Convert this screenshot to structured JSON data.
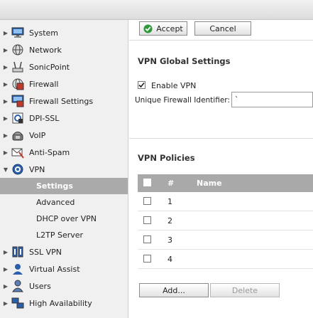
{
  "sidebar": {
    "items": [
      {
        "label": "System",
        "icon": "monitor-icon",
        "expanded": false
      },
      {
        "label": "Network",
        "icon": "globe-icon",
        "expanded": false
      },
      {
        "label": "SonicPoint",
        "icon": "access-point-icon",
        "expanded": false
      },
      {
        "label": "Firewall",
        "icon": "firewall-icon",
        "expanded": false
      },
      {
        "label": "Firewall Settings",
        "icon": "firewall-settings-icon",
        "expanded": false
      },
      {
        "label": "DPI-SSL",
        "icon": "dpi-ssl-icon",
        "expanded": false
      },
      {
        "label": "VoIP",
        "icon": "phone-icon",
        "expanded": false
      },
      {
        "label": "Anti-Spam",
        "icon": "mail-icon",
        "expanded": false
      },
      {
        "label": "VPN",
        "icon": "vpn-icon",
        "expanded": true
      },
      {
        "label": "SSL VPN",
        "icon": "ssl-vpn-icon",
        "expanded": false
      },
      {
        "label": "Virtual Assist",
        "icon": "assist-icon",
        "expanded": false
      },
      {
        "label": "Users",
        "icon": "users-icon",
        "expanded": false
      },
      {
        "label": "High Availability",
        "icon": "ha-icon",
        "expanded": false
      }
    ],
    "vpn_sub": [
      "Settings",
      "Advanced",
      "DHCP over VPN",
      "L2TP Server"
    ],
    "active_sub": "Settings"
  },
  "toolbar": {
    "accept_label": "Accept",
    "cancel_label": "Cancel"
  },
  "global": {
    "title": "VPN Global Settings",
    "enable_label": "Enable VPN",
    "enable_checked": true,
    "identifier_label": "Unique Firewall Identifier:",
    "identifier_value": "`"
  },
  "policies": {
    "title": "VPN Policies",
    "col_num": "#",
    "col_name": "Name",
    "rows": [
      {
        "num": "1",
        "name": ""
      },
      {
        "num": "2",
        "name": ""
      },
      {
        "num": "3",
        "name": ""
      },
      {
        "num": "4",
        "name": ""
      }
    ],
    "add_label": "Add...",
    "delete_label": "Delete"
  },
  "colors": {
    "active_sub_bg": "#aaaaaa",
    "table_head_bg": "#a9a9a9",
    "accept_icon": "#2e9b3a"
  }
}
